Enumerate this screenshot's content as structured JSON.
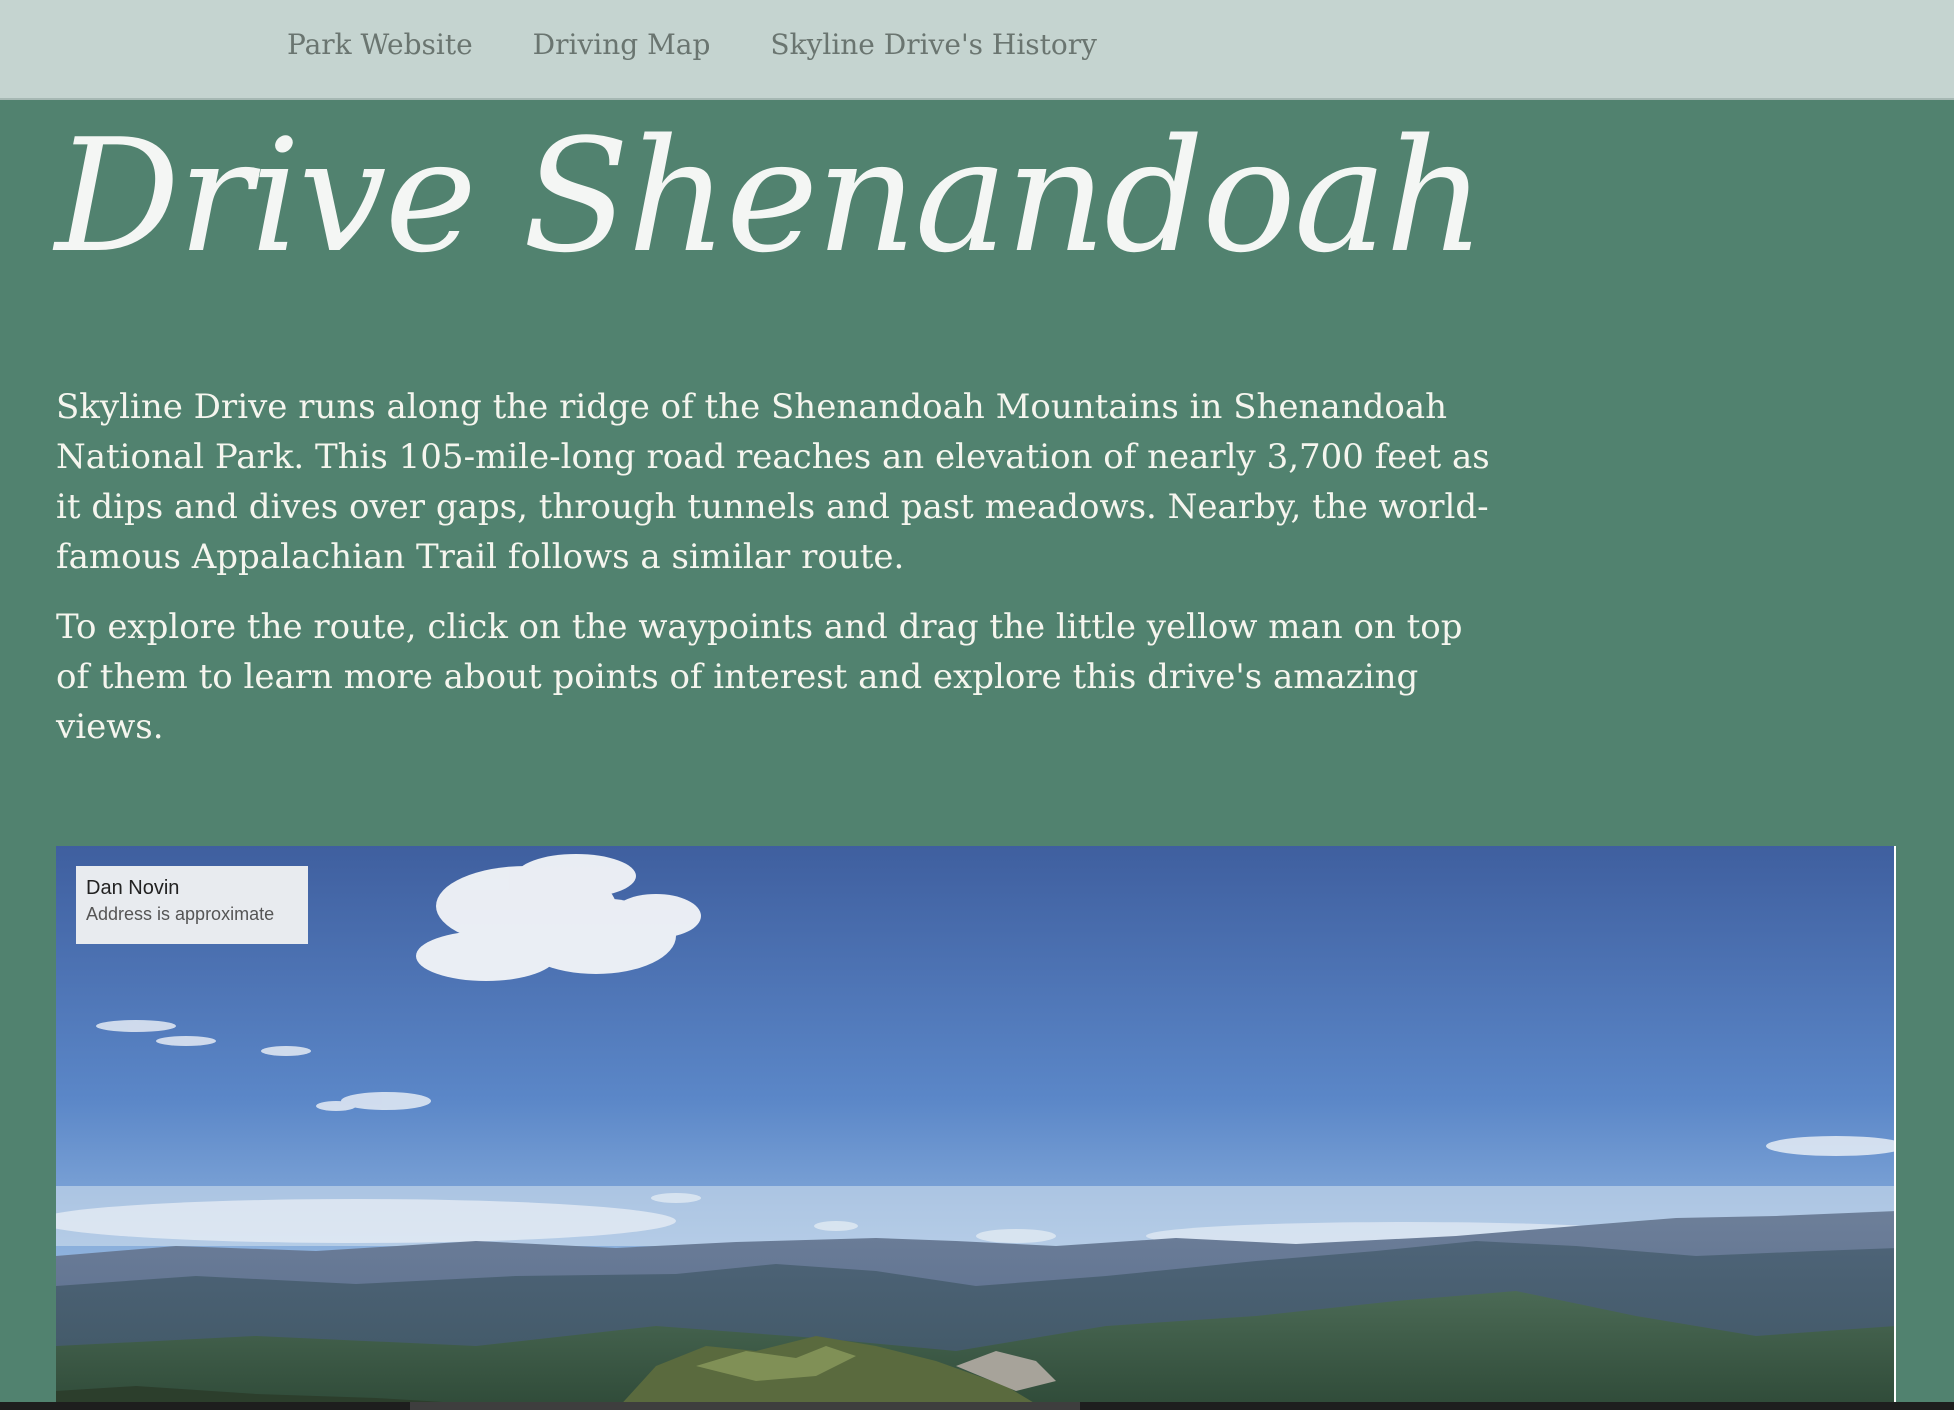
{
  "nav": {
    "items": [
      {
        "label": "Park Website"
      },
      {
        "label": "Driving Map"
      },
      {
        "label": "Skyline Drive's History"
      }
    ]
  },
  "page": {
    "title": "Drive Shenandoah",
    "paragraphs": [
      "Skyline Drive runs along the ridge of the Shenandoah Mountains in Shenandoah National Park. This 105-mile-long road reaches an elevation of nearly 3,700 feet as it dips and dives over gaps, through tunnels and past meadows. Nearby, the world-famous Appalachian Trail follows a similar route.",
      "To explore the route, click on the waypoints and drag the little yellow man on top of them to learn more about points of interest and explore this drive's amazing views."
    ]
  },
  "streetview": {
    "author": "Dan Novin",
    "address_note": "Address is approximate"
  },
  "colors": {
    "background": "#51826f",
    "nav_bg": "#c5d4d0",
    "nav_text": "#6a7570",
    "text": "#f5f5ee"
  }
}
